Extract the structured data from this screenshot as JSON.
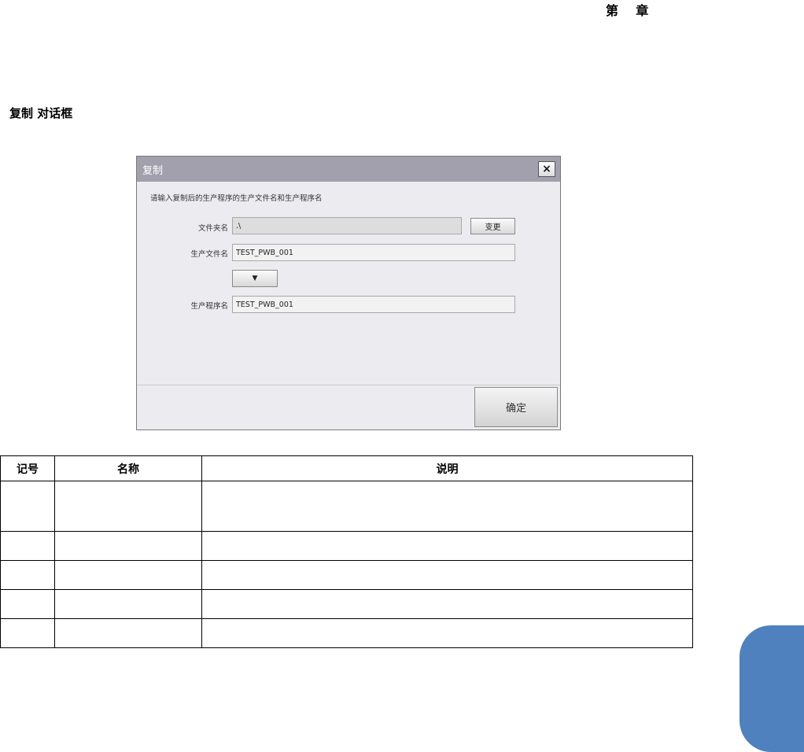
{
  "page": {
    "chapter_header": "第    章",
    "section_title": "复制 对话框"
  },
  "dialog": {
    "title": "复制",
    "close_label": "×",
    "instruction": "请输入复制后的生产程序的生产文件名和生产程序名",
    "folder_label": "文件夹名",
    "folder_value": ".\\",
    "change_label": "变更",
    "file_label": "生产文件名",
    "file_value": "TEST_PWB_001",
    "copy_name_label": "▼",
    "program_label": "生产程序名",
    "program_value": "TEST_PWB_001",
    "ok_label": "确定"
  },
  "table": {
    "headers": [
      "记号",
      "名称",
      "说明"
    ],
    "rows": [
      [
        "",
        "",
        ""
      ],
      [
        "",
        "",
        ""
      ],
      [
        "",
        "",
        ""
      ],
      [
        "",
        "",
        ""
      ],
      [
        "",
        "",
        ""
      ]
    ]
  },
  "colors": {
    "titlebar": "#a2a0ac",
    "dialog_bg": "#ececf0",
    "tab_marker": "#4e81bd"
  }
}
